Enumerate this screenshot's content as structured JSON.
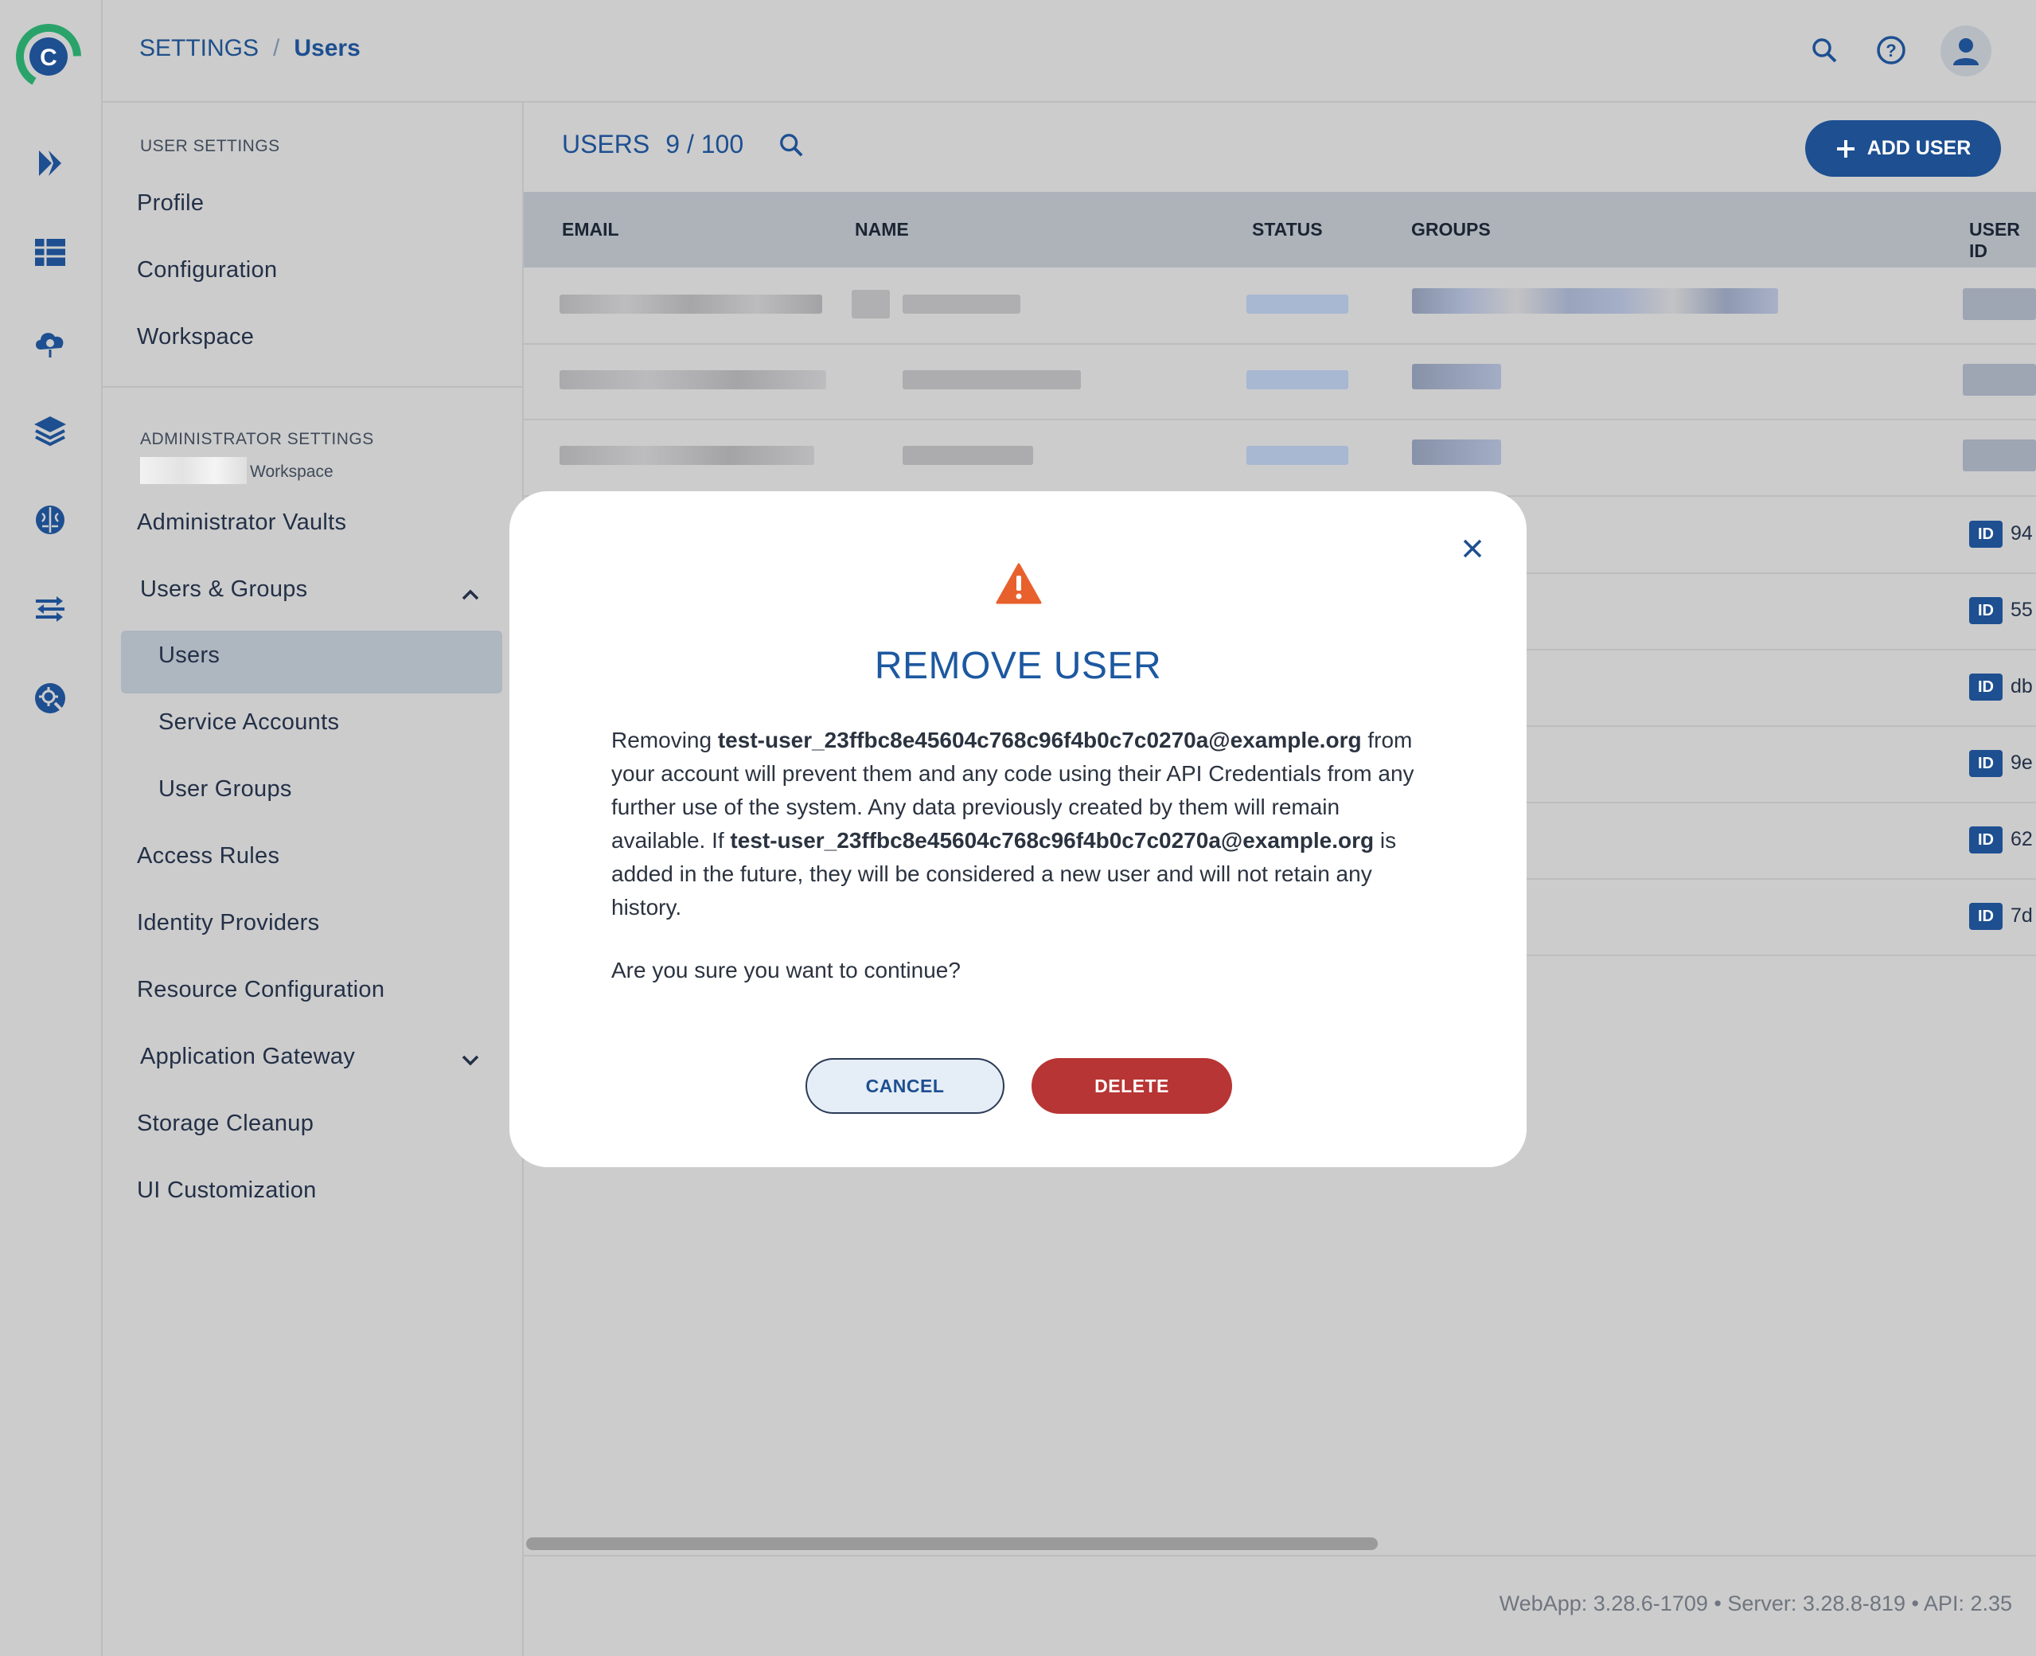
{
  "header": {
    "breadcrumb": [
      "SETTINGS",
      "/",
      "Users"
    ]
  },
  "rail": {
    "icons": [
      "app-logo-icon",
      "pipelines-icon",
      "datasets-icon",
      "compute-cloud-icon",
      "models-layers-icon",
      "brain-icon",
      "orchestration-icon",
      "settings-gear-icon"
    ]
  },
  "panel": {
    "user_settings_heading": "USER SETTINGS",
    "user_items": [
      "Profile",
      "Configuration",
      "Workspace"
    ],
    "admin_heading": "ADMINISTRATOR SETTINGS",
    "admin_subheading": "Workspace",
    "admin_items": {
      "vaults": "Administrator Vaults",
      "users_groups": "Users & Groups",
      "users": "Users",
      "service_accounts": "Service Accounts",
      "user_groups": "User Groups",
      "access_rules": "Access Rules",
      "identity_providers": "Identity Providers",
      "resource_config": "Resource Configuration",
      "app_gateway": "Application Gateway",
      "storage_cleanup": "Storage Cleanup",
      "ui_custom": "UI Customization"
    }
  },
  "main": {
    "title": "USERS",
    "count": "9 / 100",
    "add_user": "ADD USER",
    "columns": [
      "EMAIL",
      "NAME",
      "STATUS",
      "GROUPS",
      "USER ID"
    ],
    "id_badge": "ID",
    "user_ids": [
      "94",
      "55",
      "db",
      "9e",
      "62",
      "7d"
    ],
    "version": "WebApp: 3.28.6-1709 • Server: 3.28.8-819 • API: 2.35"
  },
  "modal": {
    "title": "REMOVE USER",
    "body_prefix": "Removing ",
    "email": "test-user_23ffbc8e45604c768c96f4b0c7c0270a@example.org",
    "body_middle": " from your account will prevent them and any code using their API Credentials from any further use of the system. Any data previously created by them will remain available. If ",
    "body_suffix": " is added in the future, they will be considered a new user and will not retain any history.",
    "confirm": "Are you sure you want to continue?",
    "cancel": "CANCEL",
    "delete": "DELETE"
  },
  "colors": {
    "primary": "#1d4f91",
    "danger": "#b73534",
    "warning": "#e8602c"
  }
}
